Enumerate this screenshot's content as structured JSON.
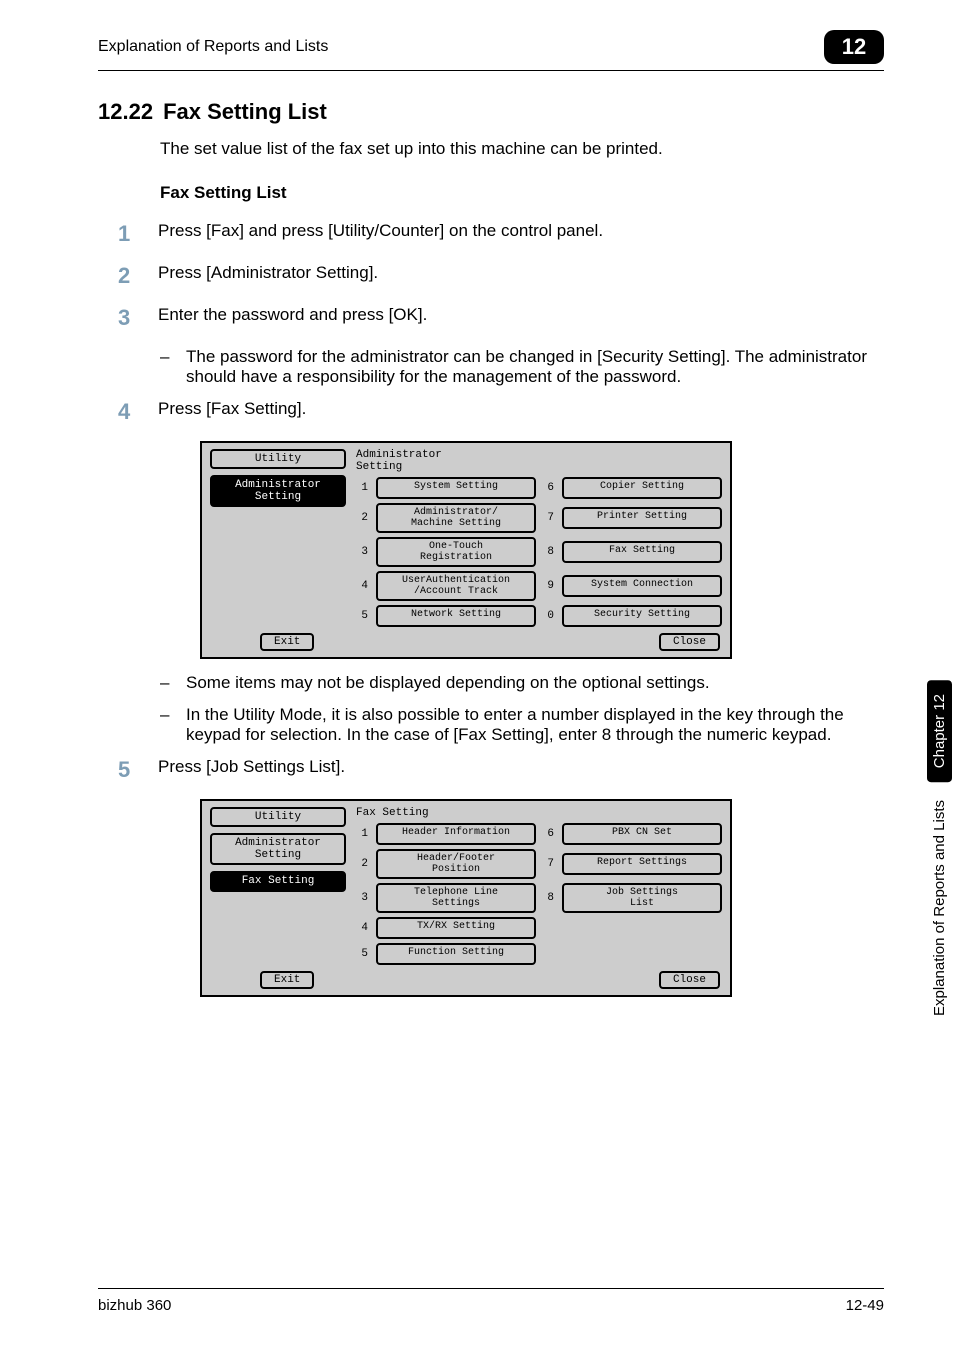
{
  "header": {
    "running_title": "Explanation of Reports and Lists",
    "chapter_number": "12"
  },
  "section": {
    "number": "12.22",
    "title": "Fax Setting List",
    "intro": "The set value list of the fax set up into this machine can be printed.",
    "subhead": "Fax Setting List"
  },
  "steps": {
    "s1": {
      "num": "1",
      "text": "Press [Fax] and press [Utility/Counter] on the control panel."
    },
    "s2": {
      "num": "2",
      "text": "Press [Administrator Setting]."
    },
    "s3": {
      "num": "3",
      "text": "Enter the password and press [OK]."
    },
    "s3_note": "The password for the administrator can be changed in [Security Setting]. The administrator should have a responsibility for the management of the password.",
    "s4": {
      "num": "4",
      "text": "Press [Fax Setting]."
    },
    "s4_note_a": "Some items may not be displayed depending on the optional settings.",
    "s4_note_b": "In the Utility Mode, it is also possible to enter a number displayed in the key through the keypad for selection. In the case of [Fax Setting], enter 8 through the numeric keypad.",
    "s5": {
      "num": "5",
      "text": "Press [Job Settings List]."
    }
  },
  "lcd_common": {
    "utility": "Utility",
    "admin_setting": "Administrator\nSetting",
    "fax_setting": "Fax Setting",
    "exit": "Exit",
    "close": "Close"
  },
  "lcd1": {
    "title_line1": "Administrator",
    "title_line2": "Setting",
    "n1": "1",
    "b1": "System Setting",
    "n2": "2",
    "b2": "Administrator/\nMachine Setting",
    "n3": "3",
    "b3": "One-Touch\nRegistration",
    "n4": "4",
    "b4": "UserAuthentication\n/Account Track",
    "n5": "5",
    "b5": "Network Setting",
    "n6": "6",
    "b6": "Copier Setting",
    "n7": "7",
    "b7": "Printer Setting",
    "n8": "8",
    "b8": "Fax Setting",
    "n9": "9",
    "b9": "System Connection",
    "n0": "0",
    "b0": "Security Setting"
  },
  "lcd2": {
    "title": "Fax Setting",
    "n1": "1",
    "b1": "Header Information",
    "n2": "2",
    "b2": "Header/Footer\nPosition",
    "n3": "3",
    "b3": "Telephone Line\nSettings",
    "n4": "4",
    "b4": "TX/RX Setting",
    "n5": "5",
    "b5": "Function Setting",
    "n6": "6",
    "b6": "PBX CN Set",
    "n7": "7",
    "b7": "Report Settings",
    "n8": "8",
    "b8": "Job Settings\nList"
  },
  "side_tab": {
    "black": "Chapter 12",
    "grey": "Explanation of Reports and Lists"
  },
  "footer": {
    "left": "bizhub 360",
    "right": "12-49"
  }
}
